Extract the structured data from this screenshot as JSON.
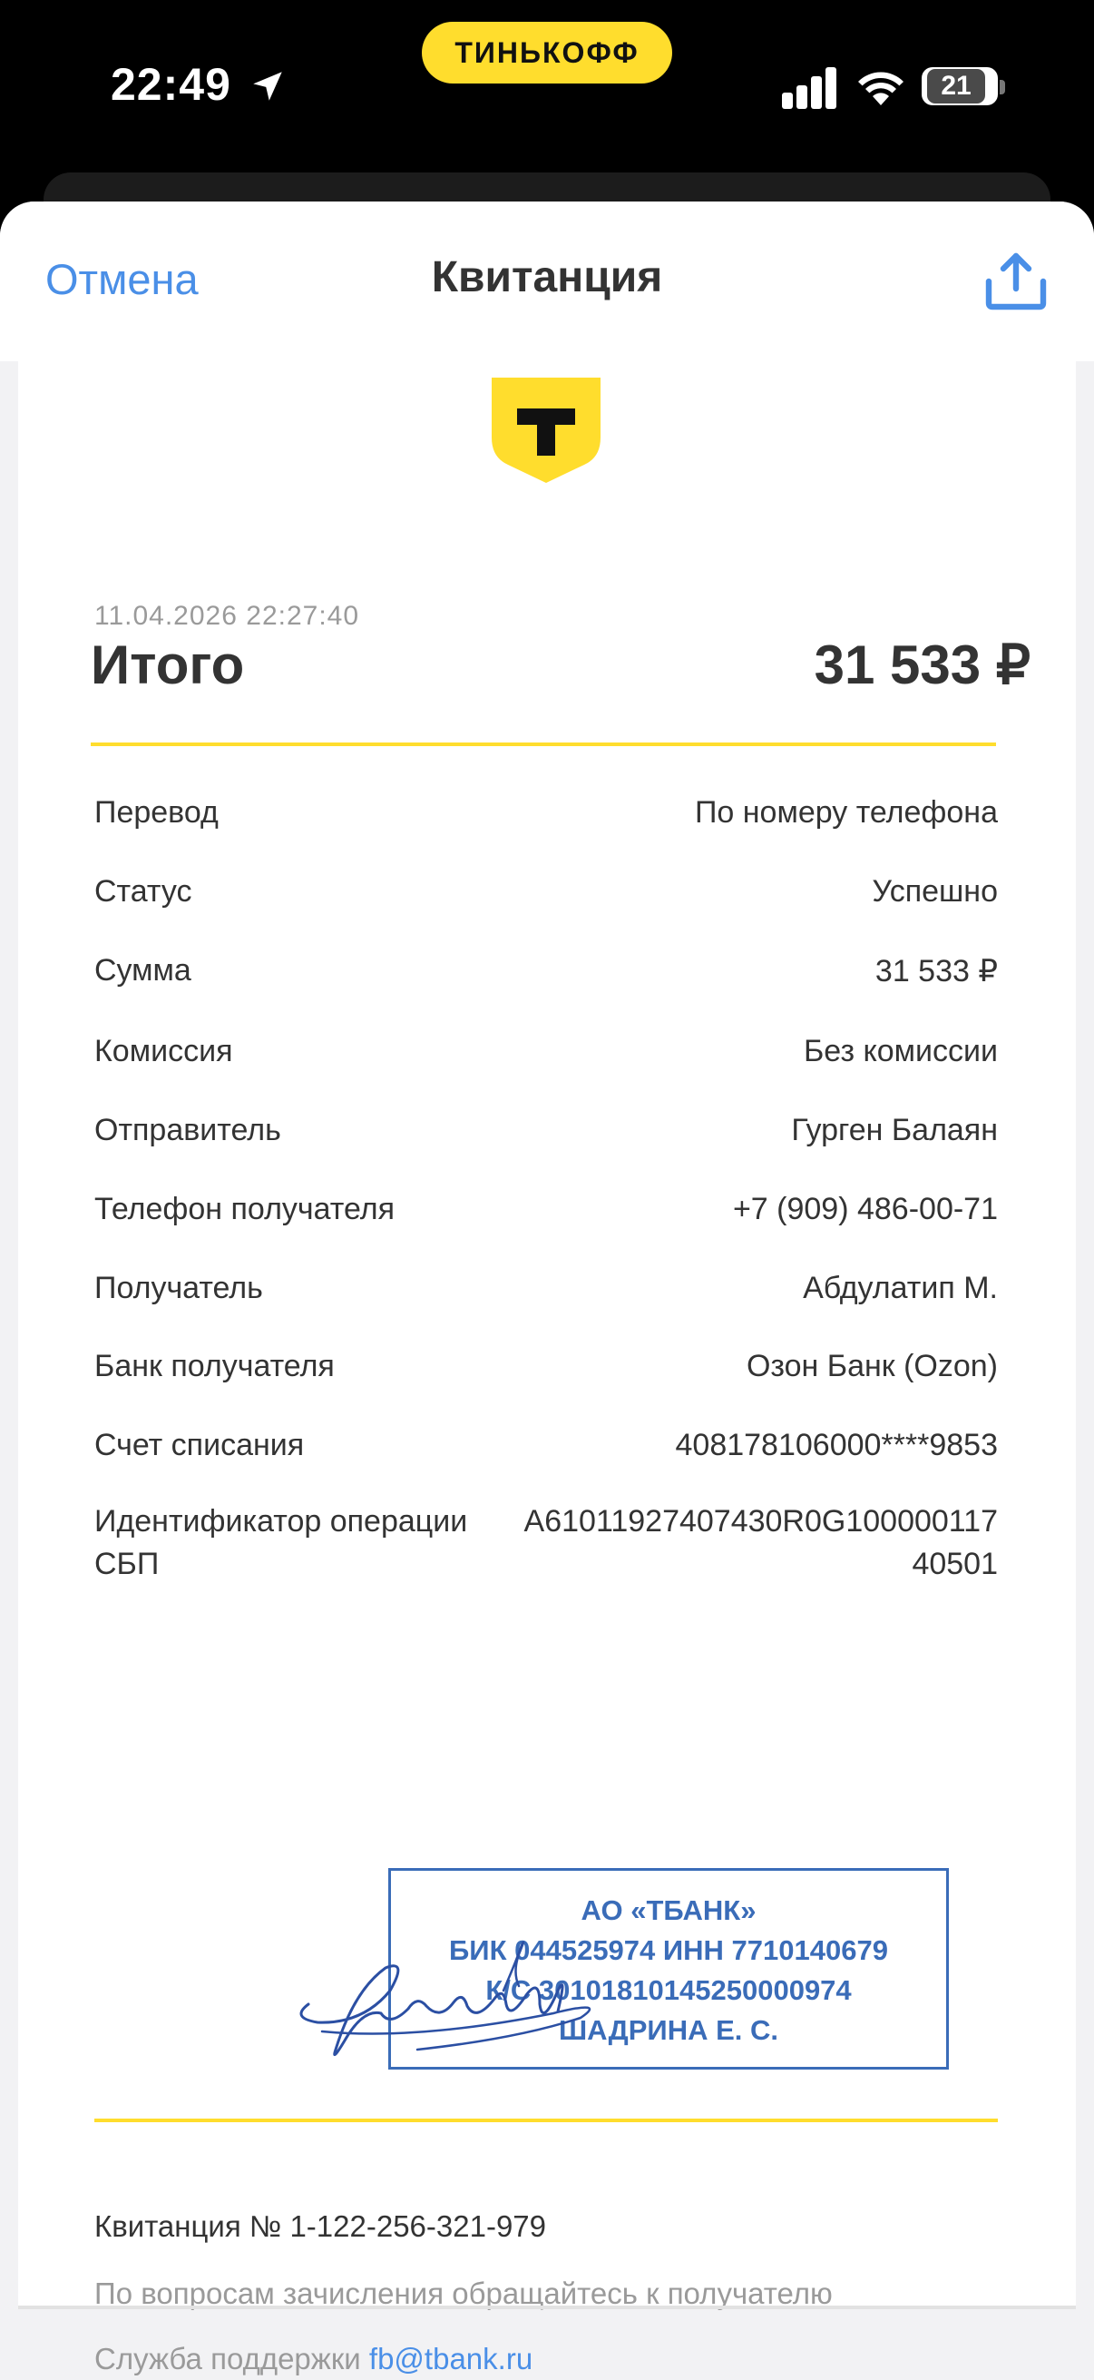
{
  "status_bar": {
    "time": "22:49",
    "brand": "ТИНЬКОФФ",
    "battery": "21",
    "location_icon": "location-arrow-icon",
    "signal_icon": "signal-icon",
    "wifi_icon": "wifi-icon"
  },
  "nav": {
    "cancel_label": "Отмена",
    "title": "Квитанция",
    "share_icon": "share-icon"
  },
  "receipt": {
    "datetime": "11.04.2026  22:27:40",
    "total_label": "Итого",
    "total_value": "31 533 ₽",
    "rows": [
      {
        "label": "Перевод",
        "value": "По номеру телефона"
      },
      {
        "label": "Статус",
        "value": "Успешно"
      },
      {
        "label": "Сумма",
        "value": "31 533 ₽"
      },
      {
        "label": "Комиссия",
        "value": "Без комиссии"
      },
      {
        "label": "Отправитель",
        "value": "Гурген Балаян"
      },
      {
        "label": "Телефон получателя",
        "value": "+7 (909) 486-00-71"
      },
      {
        "label": "Получатель",
        "value": "Абдулатип М."
      },
      {
        "label": "Банк получателя",
        "value": "Озон Банк (Ozon)"
      },
      {
        "label": "Счет списания",
        "value": "408178106000****9853"
      }
    ],
    "op_id": {
      "label_line1": "Идентификатор операции",
      "label_line2": "СБП",
      "value_line1": "A61011927407430R0G100000117",
      "value_line2": "40501"
    },
    "stamp": {
      "line1": "АО «ТБАНК»",
      "line2": "БИК 044525974 ИНН 7710140679",
      "line3": "К/С 30101810145250000974",
      "line4": "ШАДРИНА Е. С."
    },
    "receipt_number": "Квитанция  № 1-122-256-321-979",
    "note": "По вопросам зачисления обращайтесь к получателю",
    "support_label": "Служба поддержки ",
    "support_email": "fb@tbank.ru"
  },
  "colors": {
    "accent_blue": "#4a8fe7",
    "brand_yellow": "#ffdd2d",
    "stamp_blue": "#3a6cb8"
  }
}
